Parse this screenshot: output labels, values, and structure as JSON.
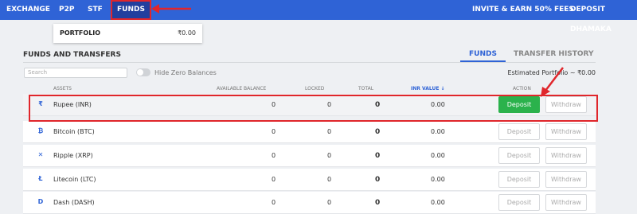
{
  "nav": {
    "exchange": "EXCHANGE",
    "p2p": "P2P",
    "stf": "STF",
    "funds": "FUNDS",
    "invite": "INVITE & EARN 50% FEES",
    "deposit_dhamaka": "DEPOSIT DHAMAKA"
  },
  "dropdown": {
    "label": "PORTFOLIO",
    "value": "₹0.00"
  },
  "section": {
    "title": "FUNDS AND TRANSFERS",
    "tabs": [
      "FUNDS",
      "TRANSFER HISTORY"
    ]
  },
  "search": {
    "placeholder": "Search"
  },
  "toggle_label": "Hide Zero Balances",
  "estimated_portfolio": "Estimated Portfolio ~ ₹0.00",
  "table": {
    "headers": [
      "ASSETS",
      "AVAILABLE BALANCE",
      "LOCKED",
      "TOTAL",
      "INR VALUE ↓",
      "ACTION"
    ],
    "rows": [
      {
        "icon": "rupee-icon",
        "glyph": "₹",
        "asset": "Rupee (INR)",
        "available": "0",
        "locked": "0",
        "total": "0",
        "inr_value": "0.00",
        "deposit": "Deposit",
        "withdraw": "Withdraw"
      },
      {
        "icon": "bitcoin-icon",
        "glyph": "₿",
        "asset": "Bitcoin (BTC)",
        "available": "0",
        "locked": "0",
        "total": "0",
        "inr_value": "0.00",
        "deposit": "Deposit",
        "withdraw": "Withdraw"
      },
      {
        "icon": "ripple-icon",
        "glyph": "✕",
        "asset": "Ripple (XRP)",
        "available": "0",
        "locked": "0",
        "total": "0",
        "inr_value": "0.00",
        "deposit": "Deposit",
        "withdraw": "Withdraw"
      },
      {
        "icon": "litecoin-icon",
        "glyph": "Ł",
        "asset": "Litecoin (LTC)",
        "available": "0",
        "locked": "0",
        "total": "0",
        "inr_value": "0.00",
        "deposit": "Deposit",
        "withdraw": "Withdraw"
      },
      {
        "icon": "dash-icon",
        "glyph": "D",
        "asset": "Dash (DASH)",
        "available": "0",
        "locked": "0",
        "total": "0",
        "inr_value": "0.00",
        "deposit": "Deposit",
        "withdraw": "Withdraw"
      }
    ]
  },
  "colors": {
    "nav_bg": "#2f63d6",
    "active_tab": "#223f9e",
    "deposit_active": "#2bb24c",
    "annotation": "#e0262b"
  }
}
